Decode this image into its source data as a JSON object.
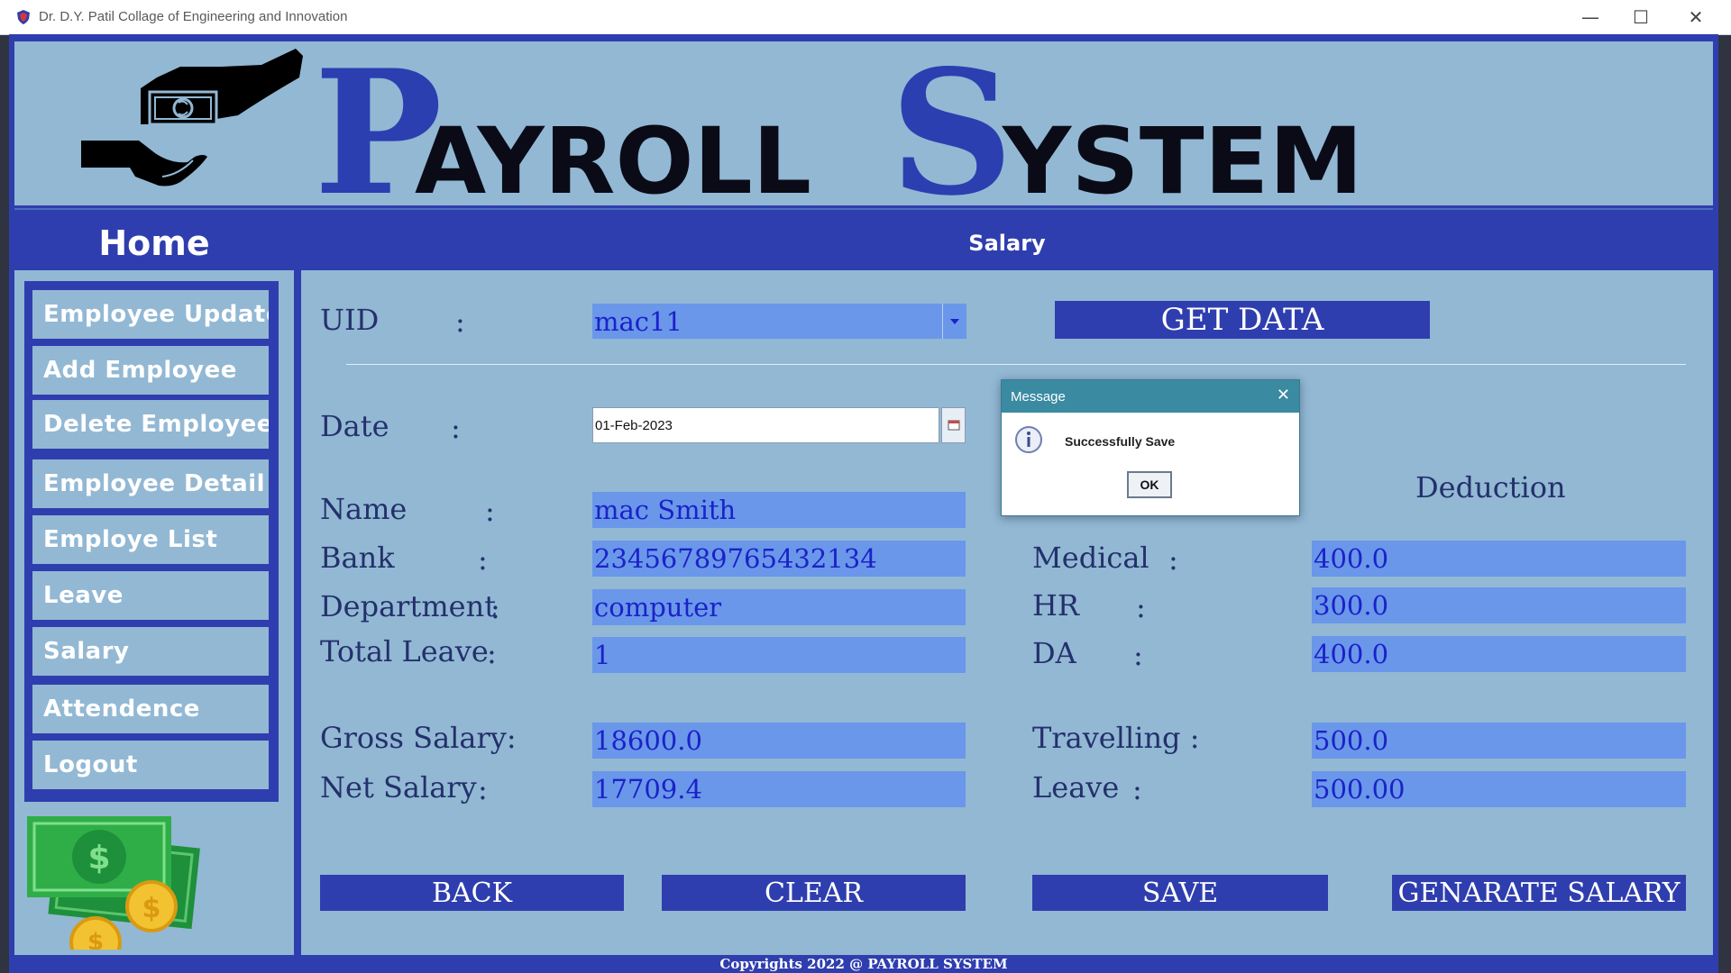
{
  "window": {
    "title": "Dr. D.Y. Patil Collage of Engineering and Innovation",
    "icon": "app-shield-icon",
    "controls": [
      "minimize-icon",
      "maximize-icon",
      "close-icon"
    ]
  },
  "banner": {
    "big_p": "P",
    "rest_payroll": "AYROLL",
    "big_s": "S",
    "rest_system": "YSTEM",
    "logo_icon": "money-hand-icon"
  },
  "colors": {
    "accent": "#2f3eae",
    "background": "#92b8d4",
    "field": "#6a97ea",
    "field_text": "#1b22c8"
  },
  "sidebar": {
    "home_label": "Home",
    "items": [
      {
        "label": "Employee Update"
      },
      {
        "label": "Add Employee"
      },
      {
        "label": "Delete Employee"
      },
      {
        "label": "Employee Detail"
      },
      {
        "label": "Employe List"
      },
      {
        "label": "Leave"
      },
      {
        "label": "Salary"
      },
      {
        "label": "Attendence"
      },
      {
        "label": "Logout"
      }
    ],
    "illustration_icon": "money-coins-icon"
  },
  "main": {
    "section_title": "Salary",
    "uid_label": "UID",
    "colon": ":",
    "uid_value": "mac11",
    "get_data_label": "GET DATA",
    "date_label": "Date",
    "date_value": "01-Feb-2023",
    "deduction_title": "Deduction",
    "left_fields": {
      "name": {
        "label": "Name",
        "value": "mac Smith"
      },
      "bank": {
        "label": "Bank",
        "value": "23456789765432134"
      },
      "department": {
        "label": "Department",
        "value": "computer"
      },
      "total_leave": {
        "label": "Total Leave",
        "value": "1"
      },
      "gross_salary": {
        "label": "Gross Salary:",
        "value": "18600.0"
      },
      "net_salary": {
        "label": "Net Salary",
        "value": "17709.4"
      }
    },
    "right_fields": {
      "medical": {
        "label": "Medical",
        "value": "400.0"
      },
      "hr": {
        "label": "HR",
        "value": "300.0"
      },
      "da": {
        "label": "DA",
        "value": "400.0"
      },
      "travelling": {
        "label": "Travelling :",
        "value": "500.0"
      },
      "leave": {
        "label": "Leave",
        "value": "500.00"
      }
    },
    "buttons": {
      "back": "BACK",
      "clear": "CLEAR",
      "save": "SAVE",
      "generate": "GENARATE SALARY"
    }
  },
  "dialog": {
    "title": "Message",
    "message": "Successfully Save",
    "ok_label": "OK",
    "icon": "info-icon"
  },
  "footer": {
    "text": "Copyrights 2022 @ PAYROLL SYSTEM"
  }
}
